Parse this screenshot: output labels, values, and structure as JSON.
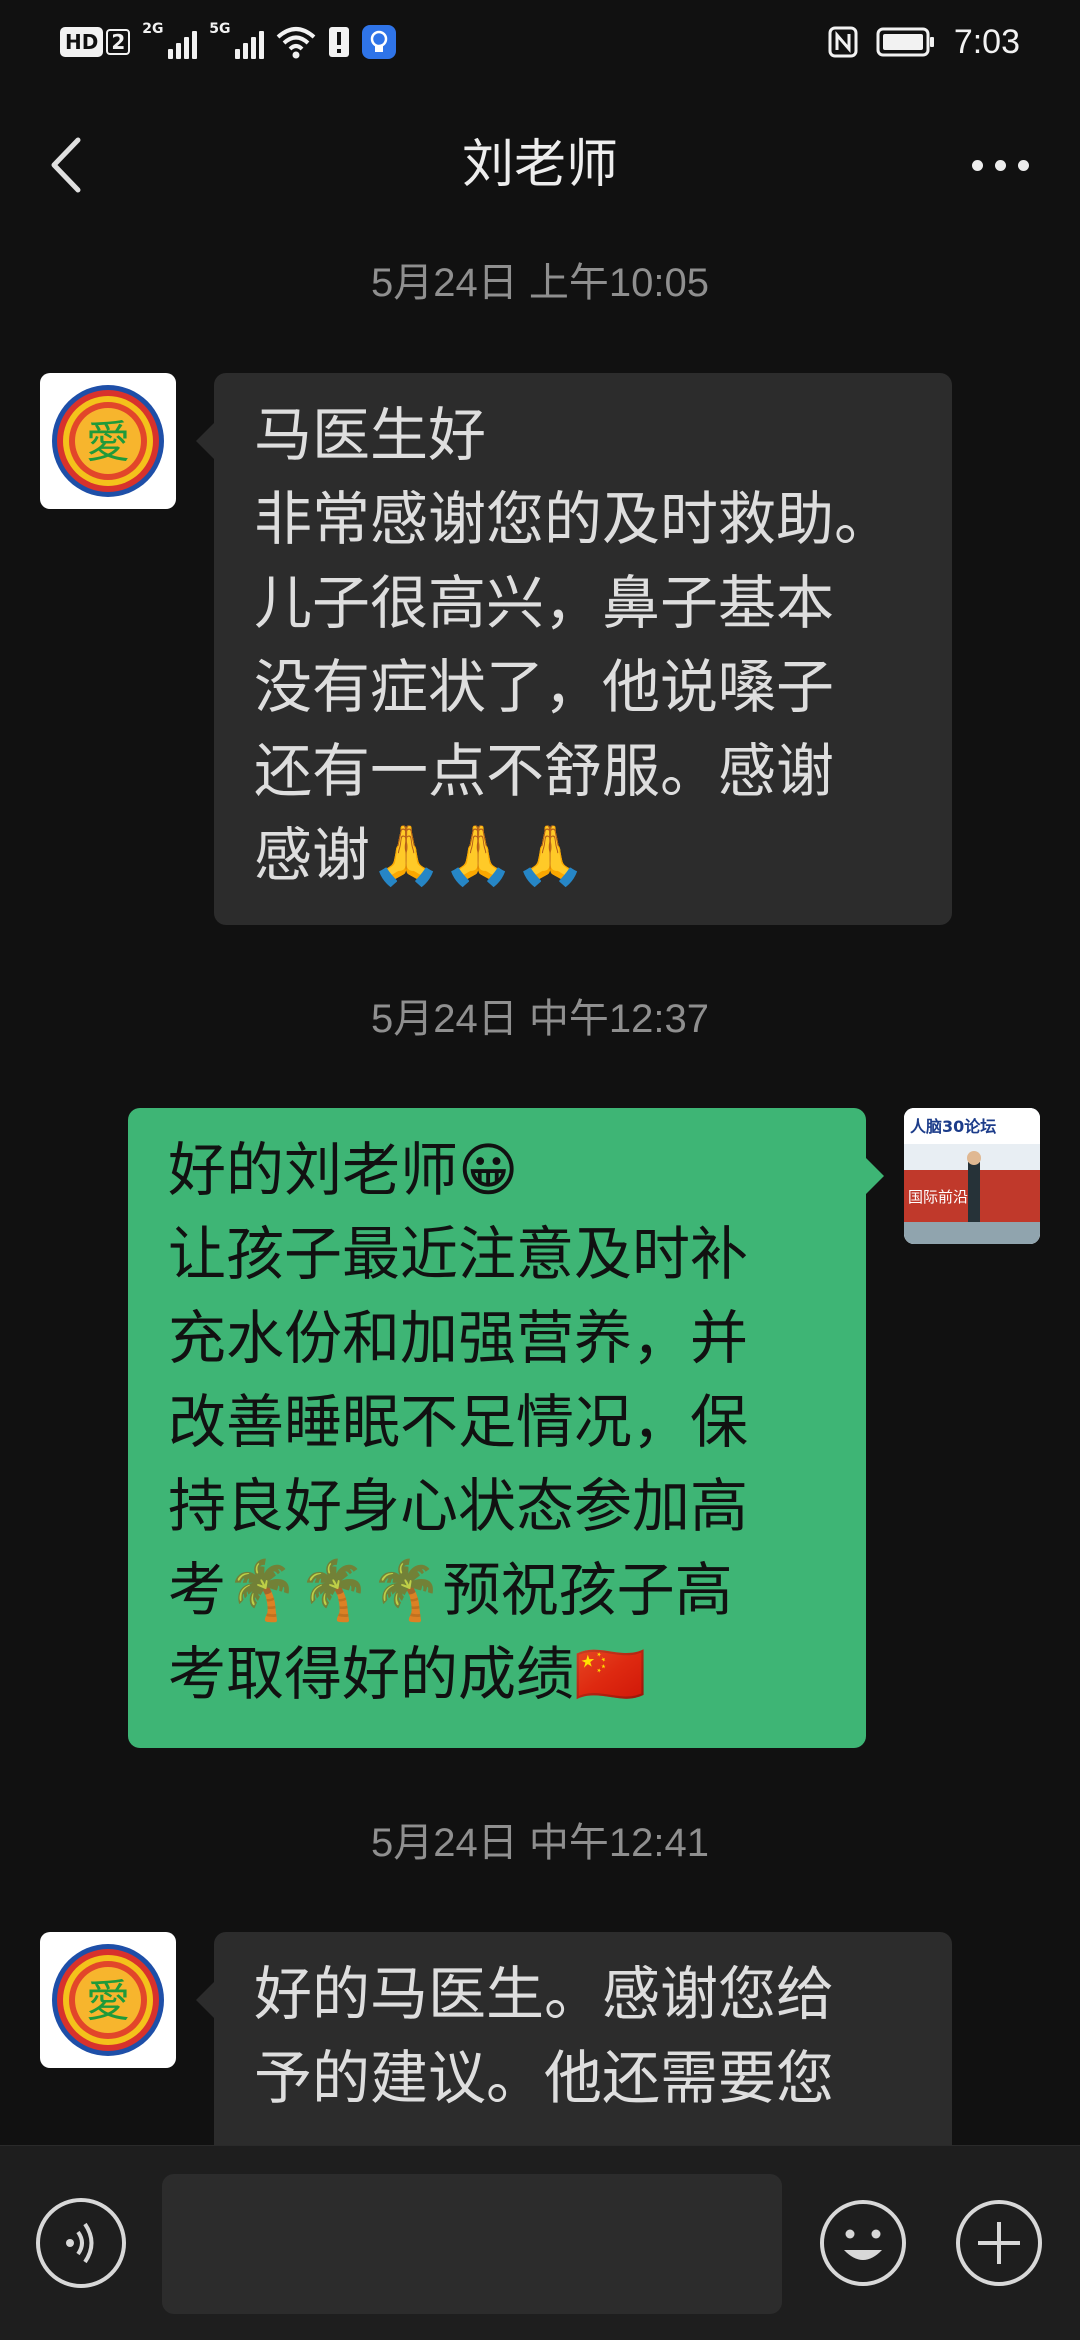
{
  "status_bar": {
    "hd_label": "HD",
    "hd_sim": "2",
    "network_1": "2G",
    "network_2": "5G",
    "time": "7:03"
  },
  "header": {
    "title": "刘老师"
  },
  "messages": [
    {
      "timestamp": "5月24日 上午10:05",
      "direction": "in",
      "avatar_text": "愛",
      "text": "马医生好\n非常感谢您的及时救助。\n儿子很高兴，鼻子基本\n没有症状了，他说嗓子\n还有一点不舒服。感谢\n感谢🙏🙏🙏"
    },
    {
      "timestamp": "5月24日 中午12:37",
      "direction": "out",
      "avatar_text": "国际前沿",
      "text": "好的刘老师😀\n让孩子最近注意及时补\n充水份和加强营养，并\n改善睡眠不足情况，保\n持良好身心状态参加高\n考🌴🌴🌴预祝孩子高\n考取得好的成绩🇨🇳"
    },
    {
      "timestamp": "5月24日 中午12:41",
      "direction": "in",
      "avatar_text": "愛",
      "text": "好的马医生。感谢您给\n予的建议。他还需要您\n"
    }
  ],
  "input": {
    "value": "",
    "placeholder": ""
  },
  "colors": {
    "background": "#111111",
    "incoming_bubble": "#2c2c2c",
    "outgoing_bubble": "#3eb575",
    "input_bar": "#1e1e1e"
  },
  "icons": {
    "back": "chevron-left-icon",
    "more": "more-dots-icon",
    "voice": "voice-icon",
    "emoji": "emoji-icon",
    "plus": "plus-icon"
  }
}
